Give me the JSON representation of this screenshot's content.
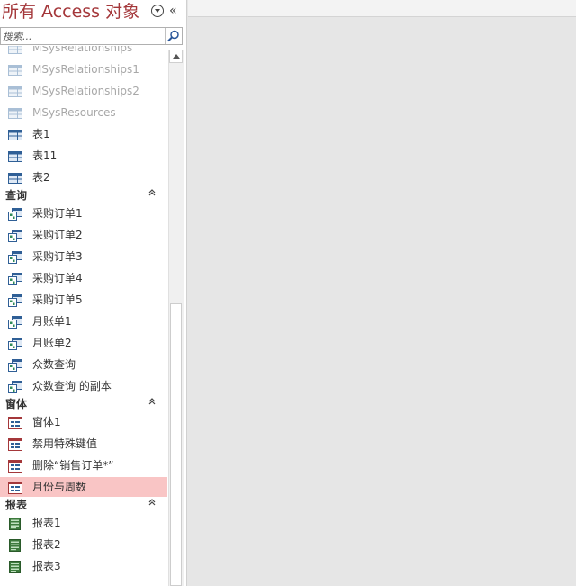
{
  "pane": {
    "title": "所有 Access 对象",
    "search_placeholder": "搜索..."
  },
  "tables": [
    {
      "label": "MSysRelationships",
      "hidden": true
    },
    {
      "label": "MSysRelationships1",
      "hidden": true
    },
    {
      "label": "MSysRelationships2",
      "hidden": true
    },
    {
      "label": "MSysResources",
      "hidden": true
    },
    {
      "label": "表1",
      "hidden": false
    },
    {
      "label": "表11",
      "hidden": false
    },
    {
      "label": "表2",
      "hidden": false
    }
  ],
  "groups": {
    "queries": "查询",
    "forms": "窗体",
    "reports": "报表"
  },
  "queries": [
    "采购订单1",
    "采购订单2",
    "采购订单3",
    "采购订单4",
    "采购订单5",
    "月账单1",
    "月账单2",
    "众数查询",
    "众数查询 的副本"
  ],
  "forms": [
    {
      "label": "窗体1",
      "selected": false
    },
    {
      "label": "禁用特殊键值",
      "selected": false
    },
    {
      "label": "删除“销售订单*”",
      "selected": false
    },
    {
      "label": "月份与周数",
      "selected": true
    }
  ],
  "reports": [
    "报表1",
    "报表2",
    "报表3"
  ],
  "colors": {
    "title": "#a4373a",
    "selected_bg": "#f9c5c5",
    "hidden_text": "#a8a8a8"
  },
  "icons": {
    "table": "table-icon",
    "query": "query-icon",
    "form": "form-icon",
    "report": "report-icon"
  }
}
